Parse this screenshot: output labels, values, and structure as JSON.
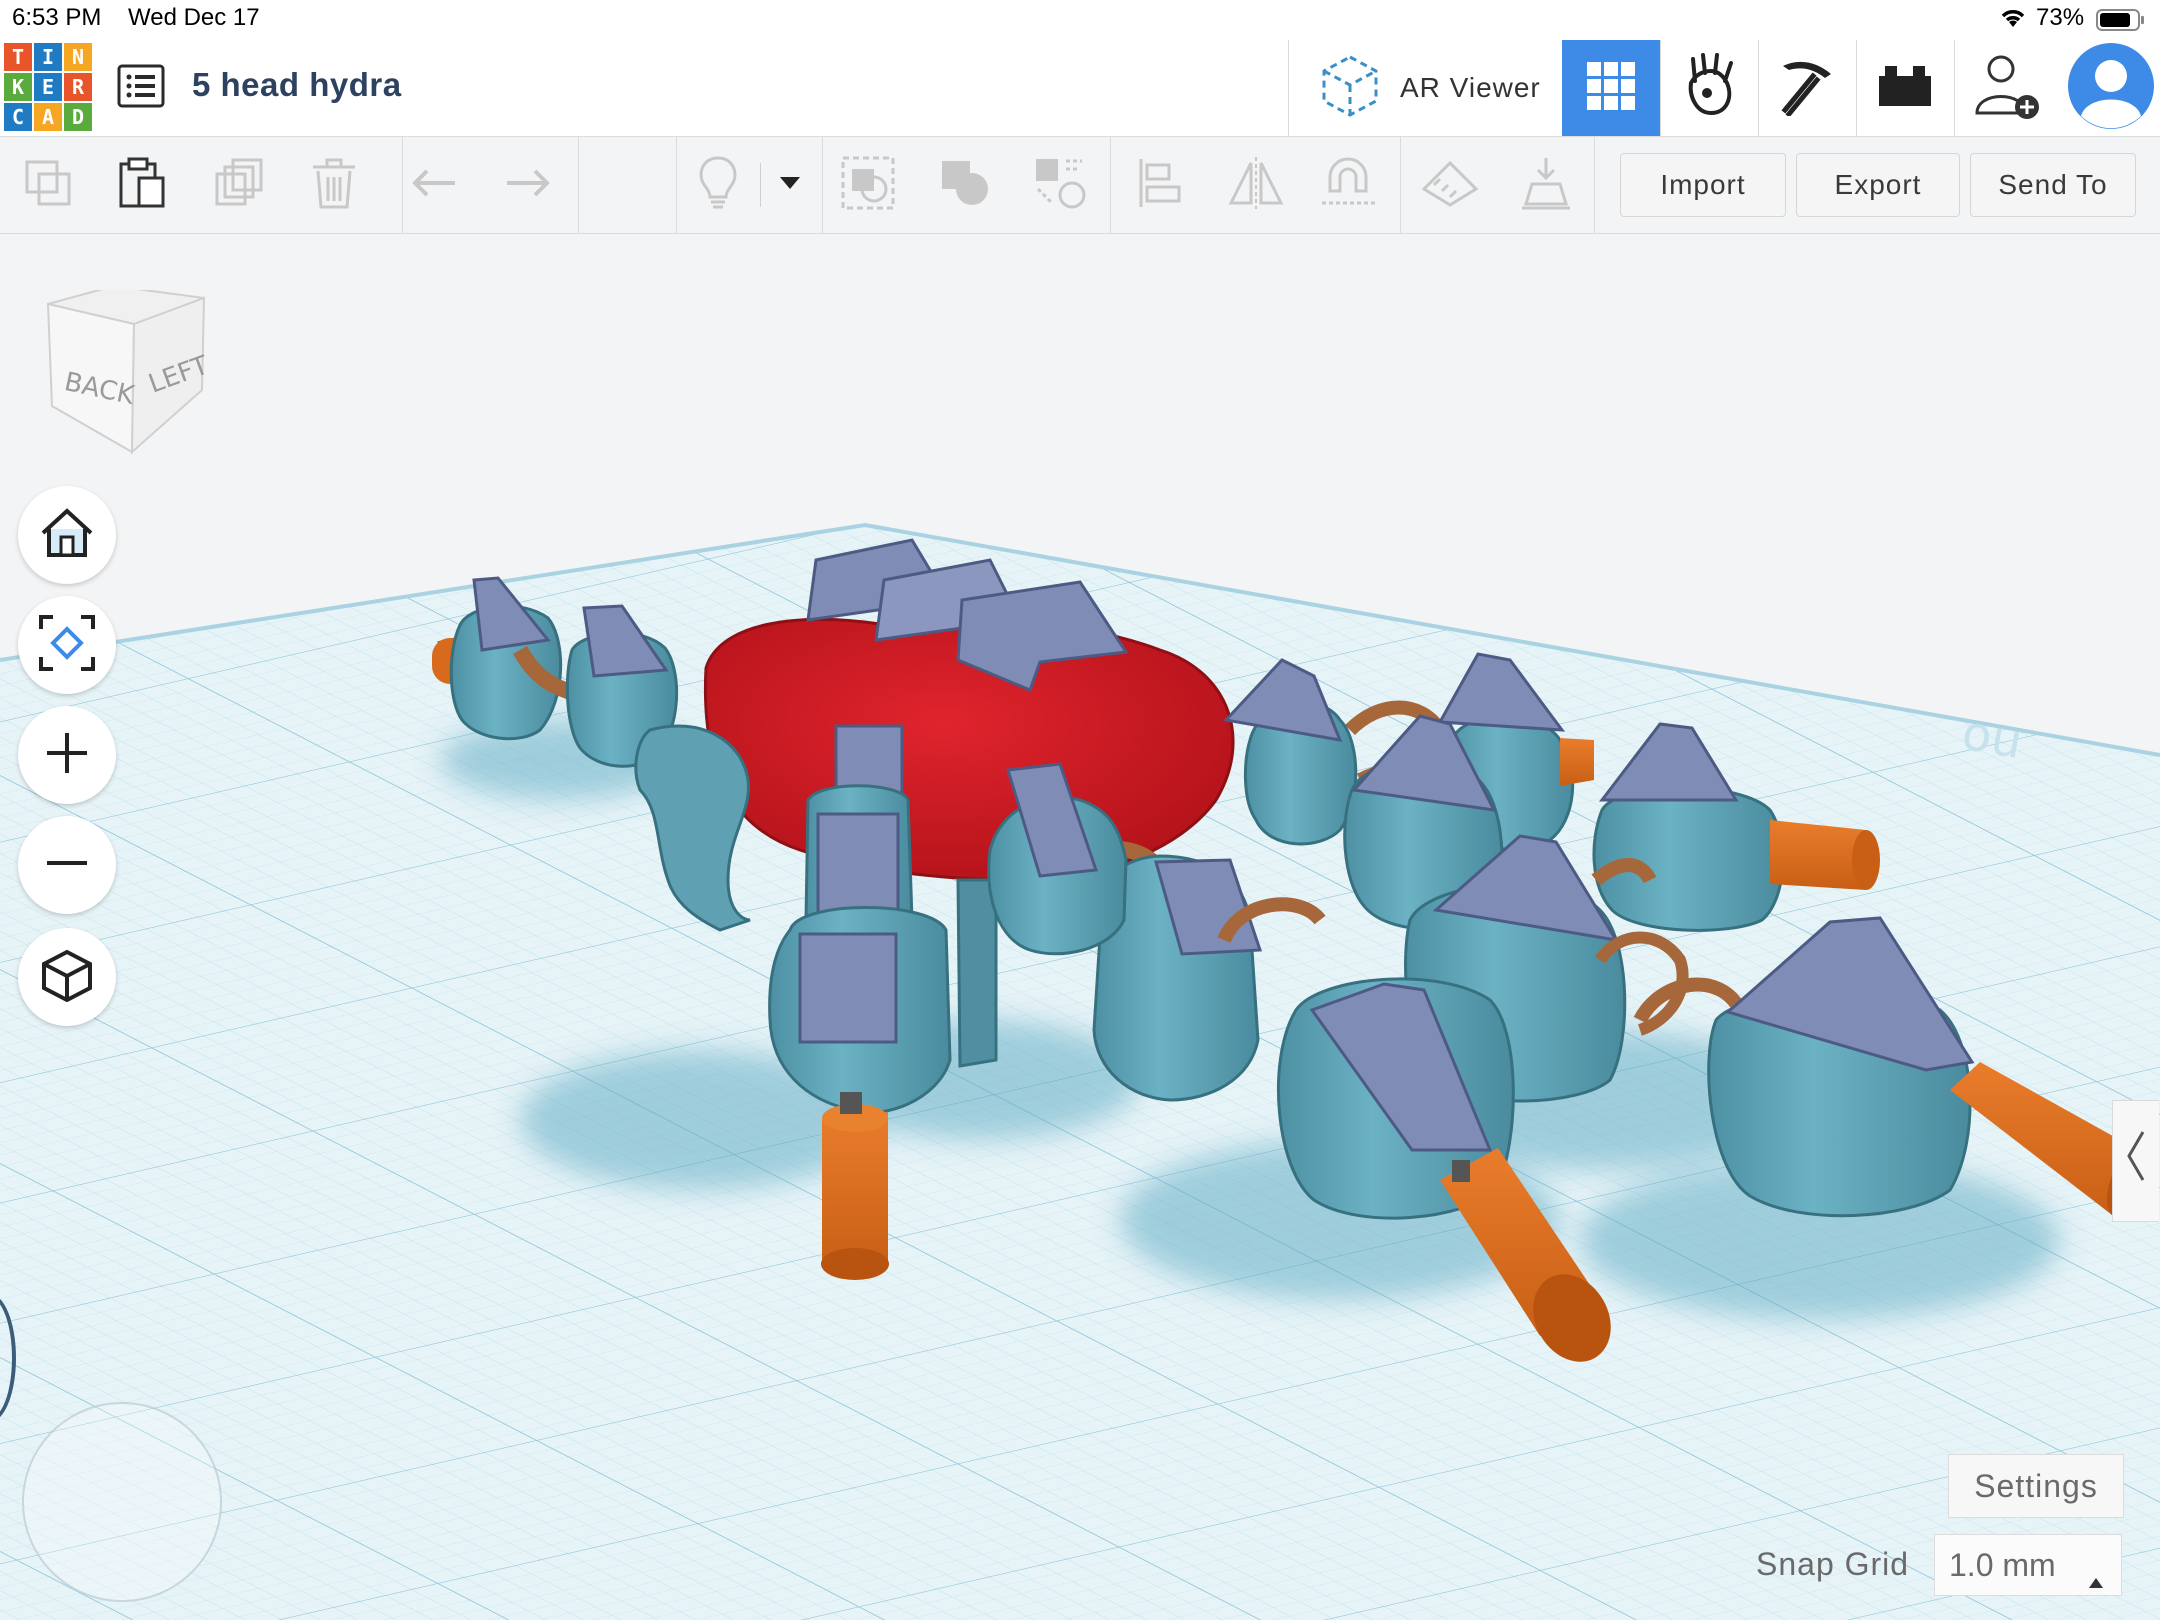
{
  "status_bar": {
    "time": "6:53 PM",
    "date": "Wed Dec 17",
    "battery": "73%"
  },
  "header": {
    "logo_letters": [
      "T",
      "I",
      "N",
      "K",
      "E",
      "R",
      "C",
      "A",
      "D"
    ],
    "logo_colors": [
      "#e8552a",
      "#1e7bc4",
      "#f5a623",
      "#5aab3d",
      "#1e7bc4",
      "#e8552a",
      "#1e7bc4",
      "#f5a623",
      "#5aab3d"
    ],
    "design_title": "5 head hydra",
    "ar_viewer_label": "AR Viewer",
    "active_view": "3d-design-grid",
    "icons": [
      "list-icon",
      "ar-viewer-icon",
      "grid-view-icon",
      "codeblocks-icon",
      "minecraft-icon",
      "lego-bricks-icon",
      "add-user-icon",
      "avatar-icon"
    ]
  },
  "toolbar": {
    "import_label": "Import",
    "export_label": "Export",
    "send_to_label": "Send To",
    "icons": [
      "copy-icon",
      "paste-icon",
      "duplicate-icon",
      "delete-icon",
      "undo-icon",
      "redo-icon",
      "lightbulb-icon",
      "dropdown-icon",
      "group-icon",
      "ungroup-icon",
      "cruise-icon",
      "align-icon",
      "mirror-icon",
      "workplane-magnet-icon",
      "ruler-icon",
      "drop-icon"
    ]
  },
  "workplane": {
    "view_cube_faces": {
      "back": "BACK",
      "left": "LEFT"
    },
    "nav_buttons": [
      "home-view-icon",
      "fit-view-icon",
      "zoom-in-icon",
      "zoom-out-icon",
      "perspective-icon"
    ],
    "settings_label": "Settings",
    "snap_grid_label": "Snap Grid",
    "snap_grid_value": "1.0 mm",
    "colors": {
      "body": "#cf1a22",
      "head": "#5fa1b3",
      "horn": "#7f8cb5",
      "cylinder": "#d86a1e",
      "ring": "#a6673a",
      "grid_bg": "#e8f4f8",
      "grid_line": "#b6dbe7"
    }
  }
}
